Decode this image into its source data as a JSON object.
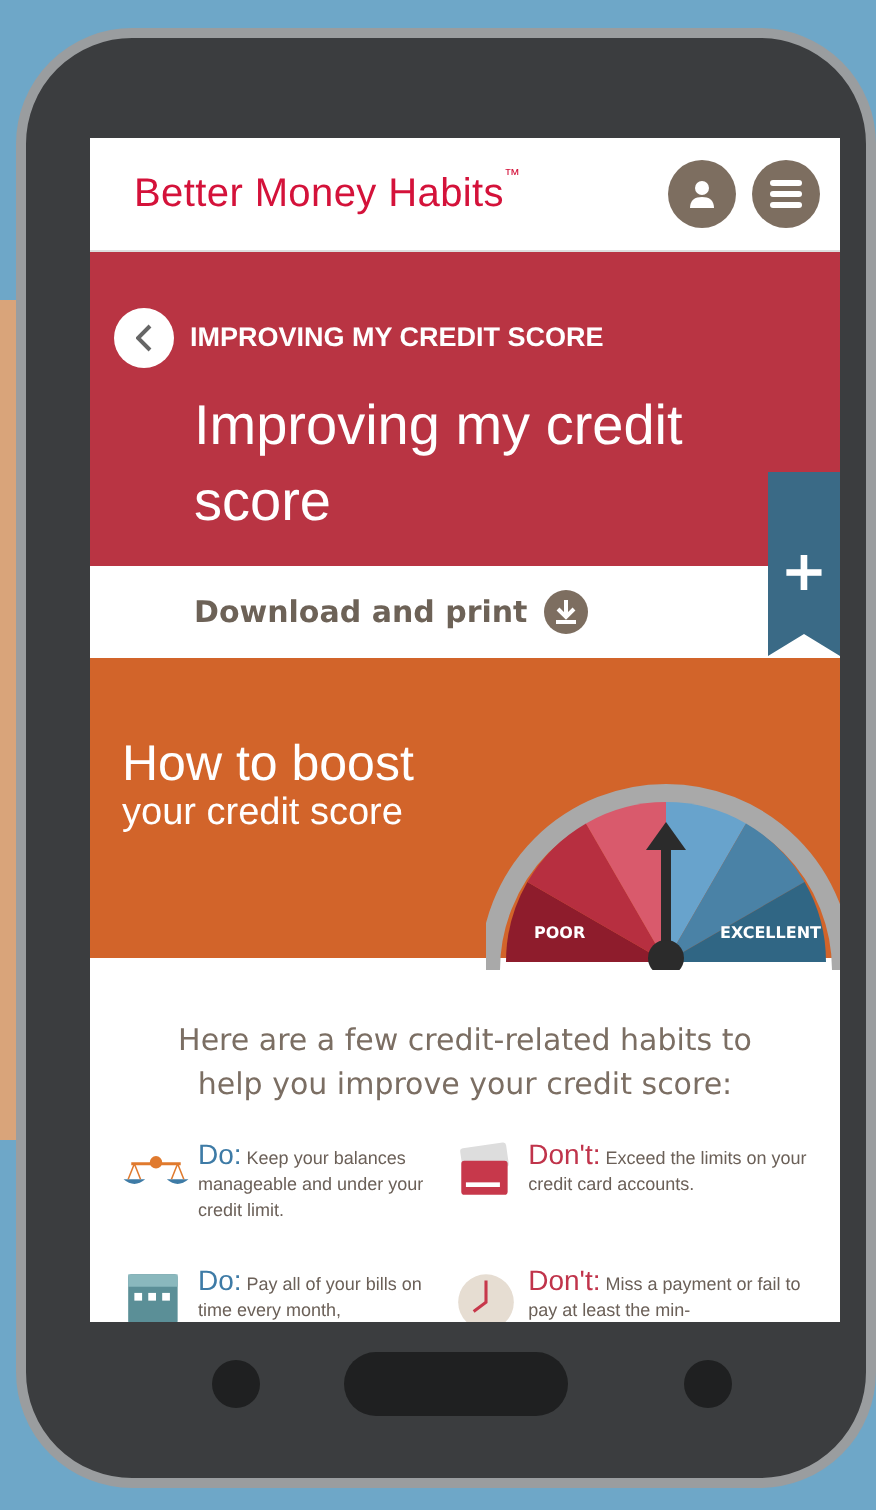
{
  "header": {
    "logo": "Better Money Habits",
    "trademark": "™"
  },
  "hero": {
    "breadcrumb": "IMPROVING MY CREDIT SCORE",
    "title": "Improving my credit score",
    "bookmark": "+"
  },
  "download": {
    "label": "Download and print"
  },
  "banner": {
    "title_line1": "How to boost",
    "title_line2": "your credit score",
    "gauge": {
      "low_label": "POOR",
      "high_label": "EXCELLENT"
    }
  },
  "intro": "Here are a few credit-related habits to help you improve your credit score:",
  "tips": [
    {
      "kind": "do",
      "lead": "Do:",
      "text": "Keep your balances manageable and under your credit limit."
    },
    {
      "kind": "dont",
      "lead": "Don't:",
      "text": "Exceed the limits on your credit card accounts."
    },
    {
      "kind": "do",
      "lead": "Do:",
      "text": "Pay all of your bills on time every month,"
    },
    {
      "kind": "dont",
      "lead": "Don't:",
      "text": "Miss a payment or fail to pay at least the min-"
    }
  ]
}
